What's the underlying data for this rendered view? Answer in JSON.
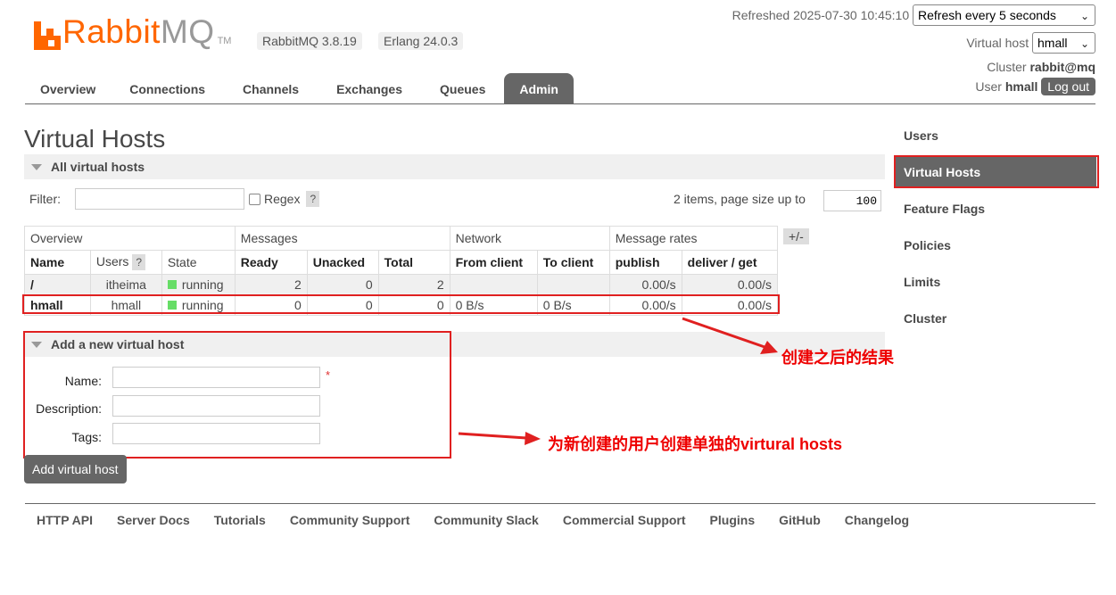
{
  "header": {
    "logo_text_1": "Rabbit",
    "logo_text_2": "MQ",
    "logo_tm": "TM",
    "version_rabbit": "RabbitMQ 3.8.19",
    "version_erlang": "Erlang 24.0.3",
    "refreshed_label": "Refreshed 2025-07-30 10:45:10",
    "refresh_select": "Refresh every 5 seconds",
    "vhost_label": "Virtual host",
    "vhost_select": "hmall",
    "cluster_label": "Cluster",
    "cluster_value": "rabbit@mq",
    "user_label": "User",
    "user_value": "hmall",
    "logout_label": "Log out"
  },
  "tabs": [
    "Overview",
    "Connections",
    "Channels",
    "Exchanges",
    "Queues",
    "Admin"
  ],
  "page_title": "Virtual Hosts",
  "all_vhosts": {
    "section_title": "All virtual hosts",
    "filter_label": "Filter:",
    "regex_label": "Regex",
    "help": "?",
    "paging_text": "2 items, page size up to",
    "page_size": "100",
    "group_headers": [
      "Overview",
      "Messages",
      "Network",
      "Message rates"
    ],
    "plusminus": "+/-",
    "columns": [
      "Name",
      "Users",
      "State",
      "Ready",
      "Unacked",
      "Total",
      "From client",
      "To client",
      "publish",
      "deliver / get"
    ],
    "rows": [
      {
        "name": "/",
        "users": "itheima",
        "state": "running",
        "ready": "2",
        "unacked": "0",
        "total": "2",
        "from_client": "",
        "to_client": "",
        "publish": "0.00/s",
        "deliver": "0.00/s"
      },
      {
        "name": "hmall",
        "users": "hmall",
        "state": "running",
        "ready": "0",
        "unacked": "0",
        "total": "0",
        "from_client": "0 B/s",
        "to_client": "0 B/s",
        "publish": "0.00/s",
        "deliver": "0.00/s"
      }
    ]
  },
  "add_vhost": {
    "section_title": "Add a new virtual host",
    "name_label": "Name:",
    "required_mark": "*",
    "description_label": "Description:",
    "tags_label": "Tags:",
    "button": "Add virtual host"
  },
  "sidebar": [
    "Users",
    "Virtual Hosts",
    "Feature Flags",
    "Policies",
    "Limits",
    "Cluster"
  ],
  "annotations": {
    "result_note": "创建之后的结果",
    "create_note": "为新创建的用户创建单独的virtural hosts"
  },
  "footer": [
    "HTTP API",
    "Server Docs",
    "Tutorials",
    "Community Support",
    "Community Slack",
    "Commercial Support",
    "Plugins",
    "GitHub",
    "Changelog"
  ],
  "colors": {
    "brand": "#ff6600",
    "accent": "#666666",
    "annotation": "#e02020",
    "running": "#66dd66"
  }
}
